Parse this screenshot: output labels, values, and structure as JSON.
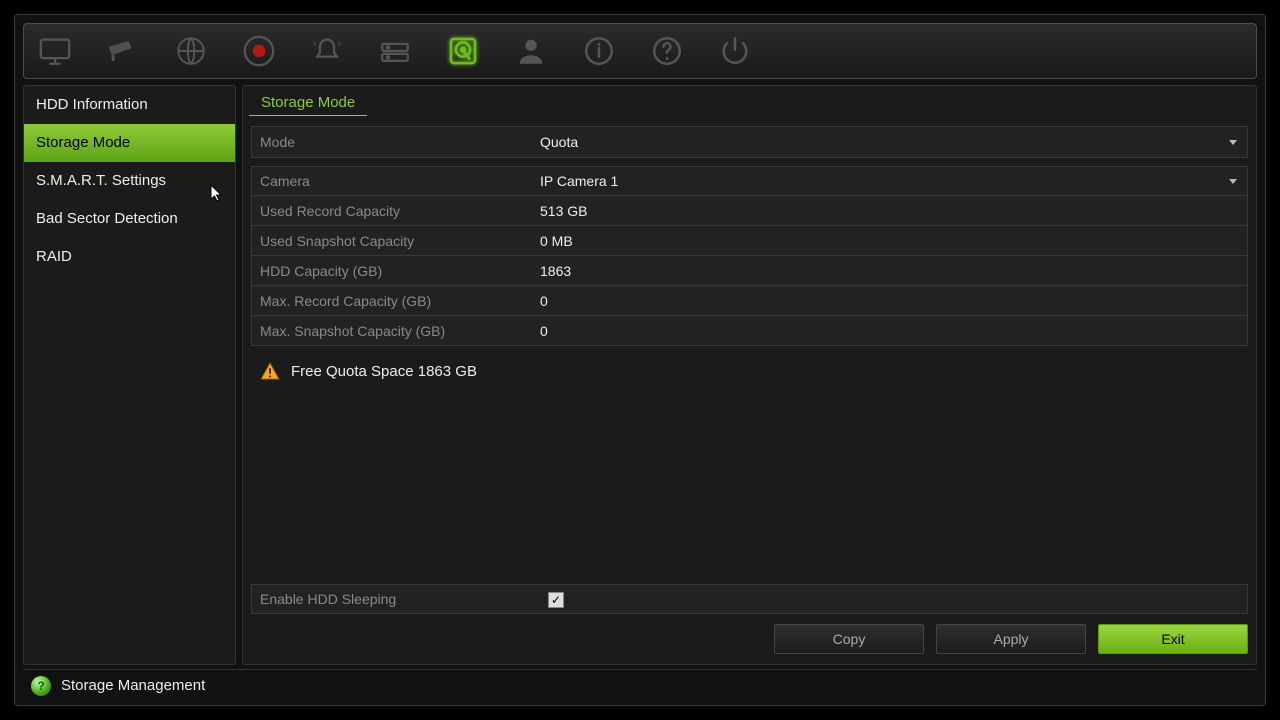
{
  "toolbar": {
    "icons": [
      "monitor",
      "camera",
      "network",
      "record",
      "alarm",
      "device",
      "hdd",
      "user",
      "info",
      "help",
      "power"
    ],
    "active": "hdd"
  },
  "sidebar": {
    "items": [
      {
        "label": "HDD Information"
      },
      {
        "label": "Storage Mode",
        "active": true
      },
      {
        "label": "S.M.A.R.T. Settings"
      },
      {
        "label": "Bad Sector Detection"
      },
      {
        "label": "RAID"
      }
    ]
  },
  "main": {
    "title": "Storage Mode",
    "mode_label": "Mode",
    "mode_value": "Quota",
    "camera_label": "Camera",
    "camera_value": "IP Camera 1",
    "rows": [
      {
        "label": "Used Record Capacity",
        "value": "513 GB"
      },
      {
        "label": "Used Snapshot Capacity",
        "value": "0 MB"
      },
      {
        "label": "HDD Capacity (GB)",
        "value": "1863"
      },
      {
        "label": "Max. Record Capacity (GB)",
        "value": "0"
      },
      {
        "label": "Max. Snapshot Capacity (GB)",
        "value": "0"
      }
    ],
    "free_quota": "Free Quota Space 1863 GB",
    "enable_sleep_label": "Enable HDD Sleeping",
    "enable_sleep_checked": true
  },
  "buttons": {
    "copy": "Copy",
    "apply": "Apply",
    "exit": "Exit"
  },
  "footer": {
    "label": "Storage Management"
  },
  "colors": {
    "accent": "#8ecb3a"
  }
}
